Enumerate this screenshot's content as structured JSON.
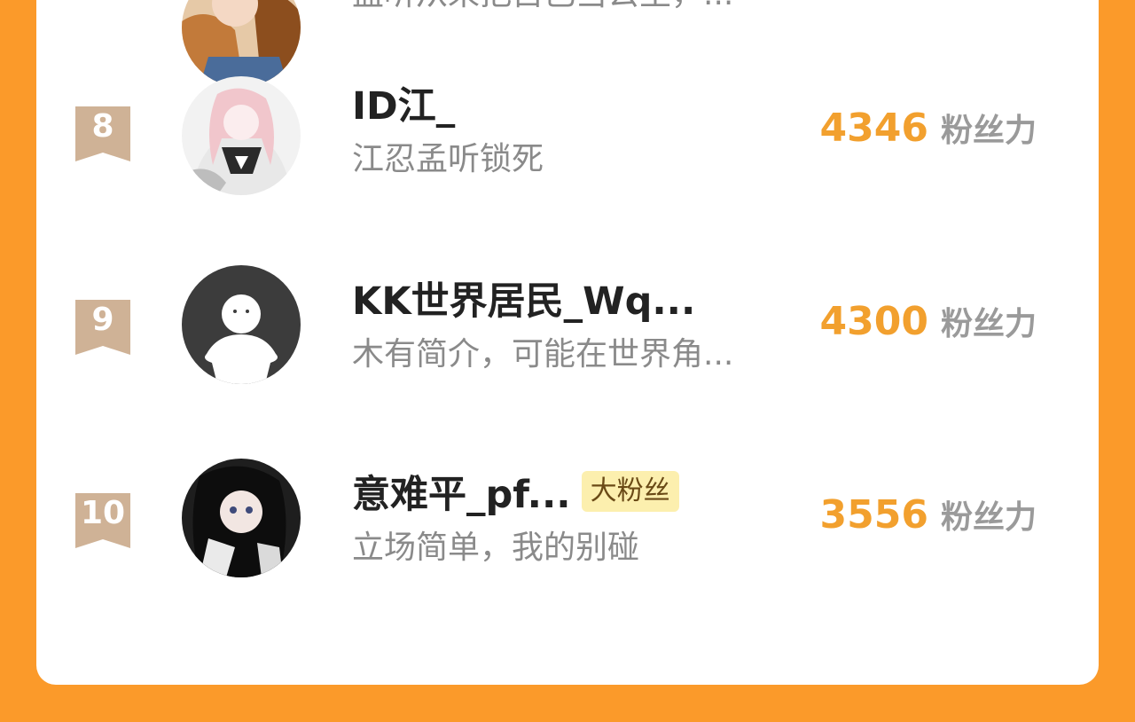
{
  "colors": {
    "background": "#FB9A2A",
    "card": "#FFFFFF",
    "score": "#F2A02E",
    "badge": "#CFB296"
  },
  "partial_row": {
    "desc": "孟听从来把自己当公主，..."
  },
  "rows": [
    {
      "rank": "8",
      "name": "ID江_",
      "desc": "江忍孟听锁死",
      "score": "4346",
      "unit": "粉丝力",
      "avatar": "anime-pink-hair-avatar"
    },
    {
      "rank": "9",
      "name": "KK世界居民_Wq...",
      "desc": "木有简介，可能在世界角...",
      "score": "4300",
      "unit": "粉丝力",
      "avatar": "default-user-avatar"
    },
    {
      "rank": "10",
      "name": "意难平_pf...",
      "tag": "大粉丝",
      "desc": "立场简单，我的别碰",
      "score": "3556",
      "unit": "粉丝力",
      "avatar": "anime-dark-hair-avatar"
    }
  ]
}
